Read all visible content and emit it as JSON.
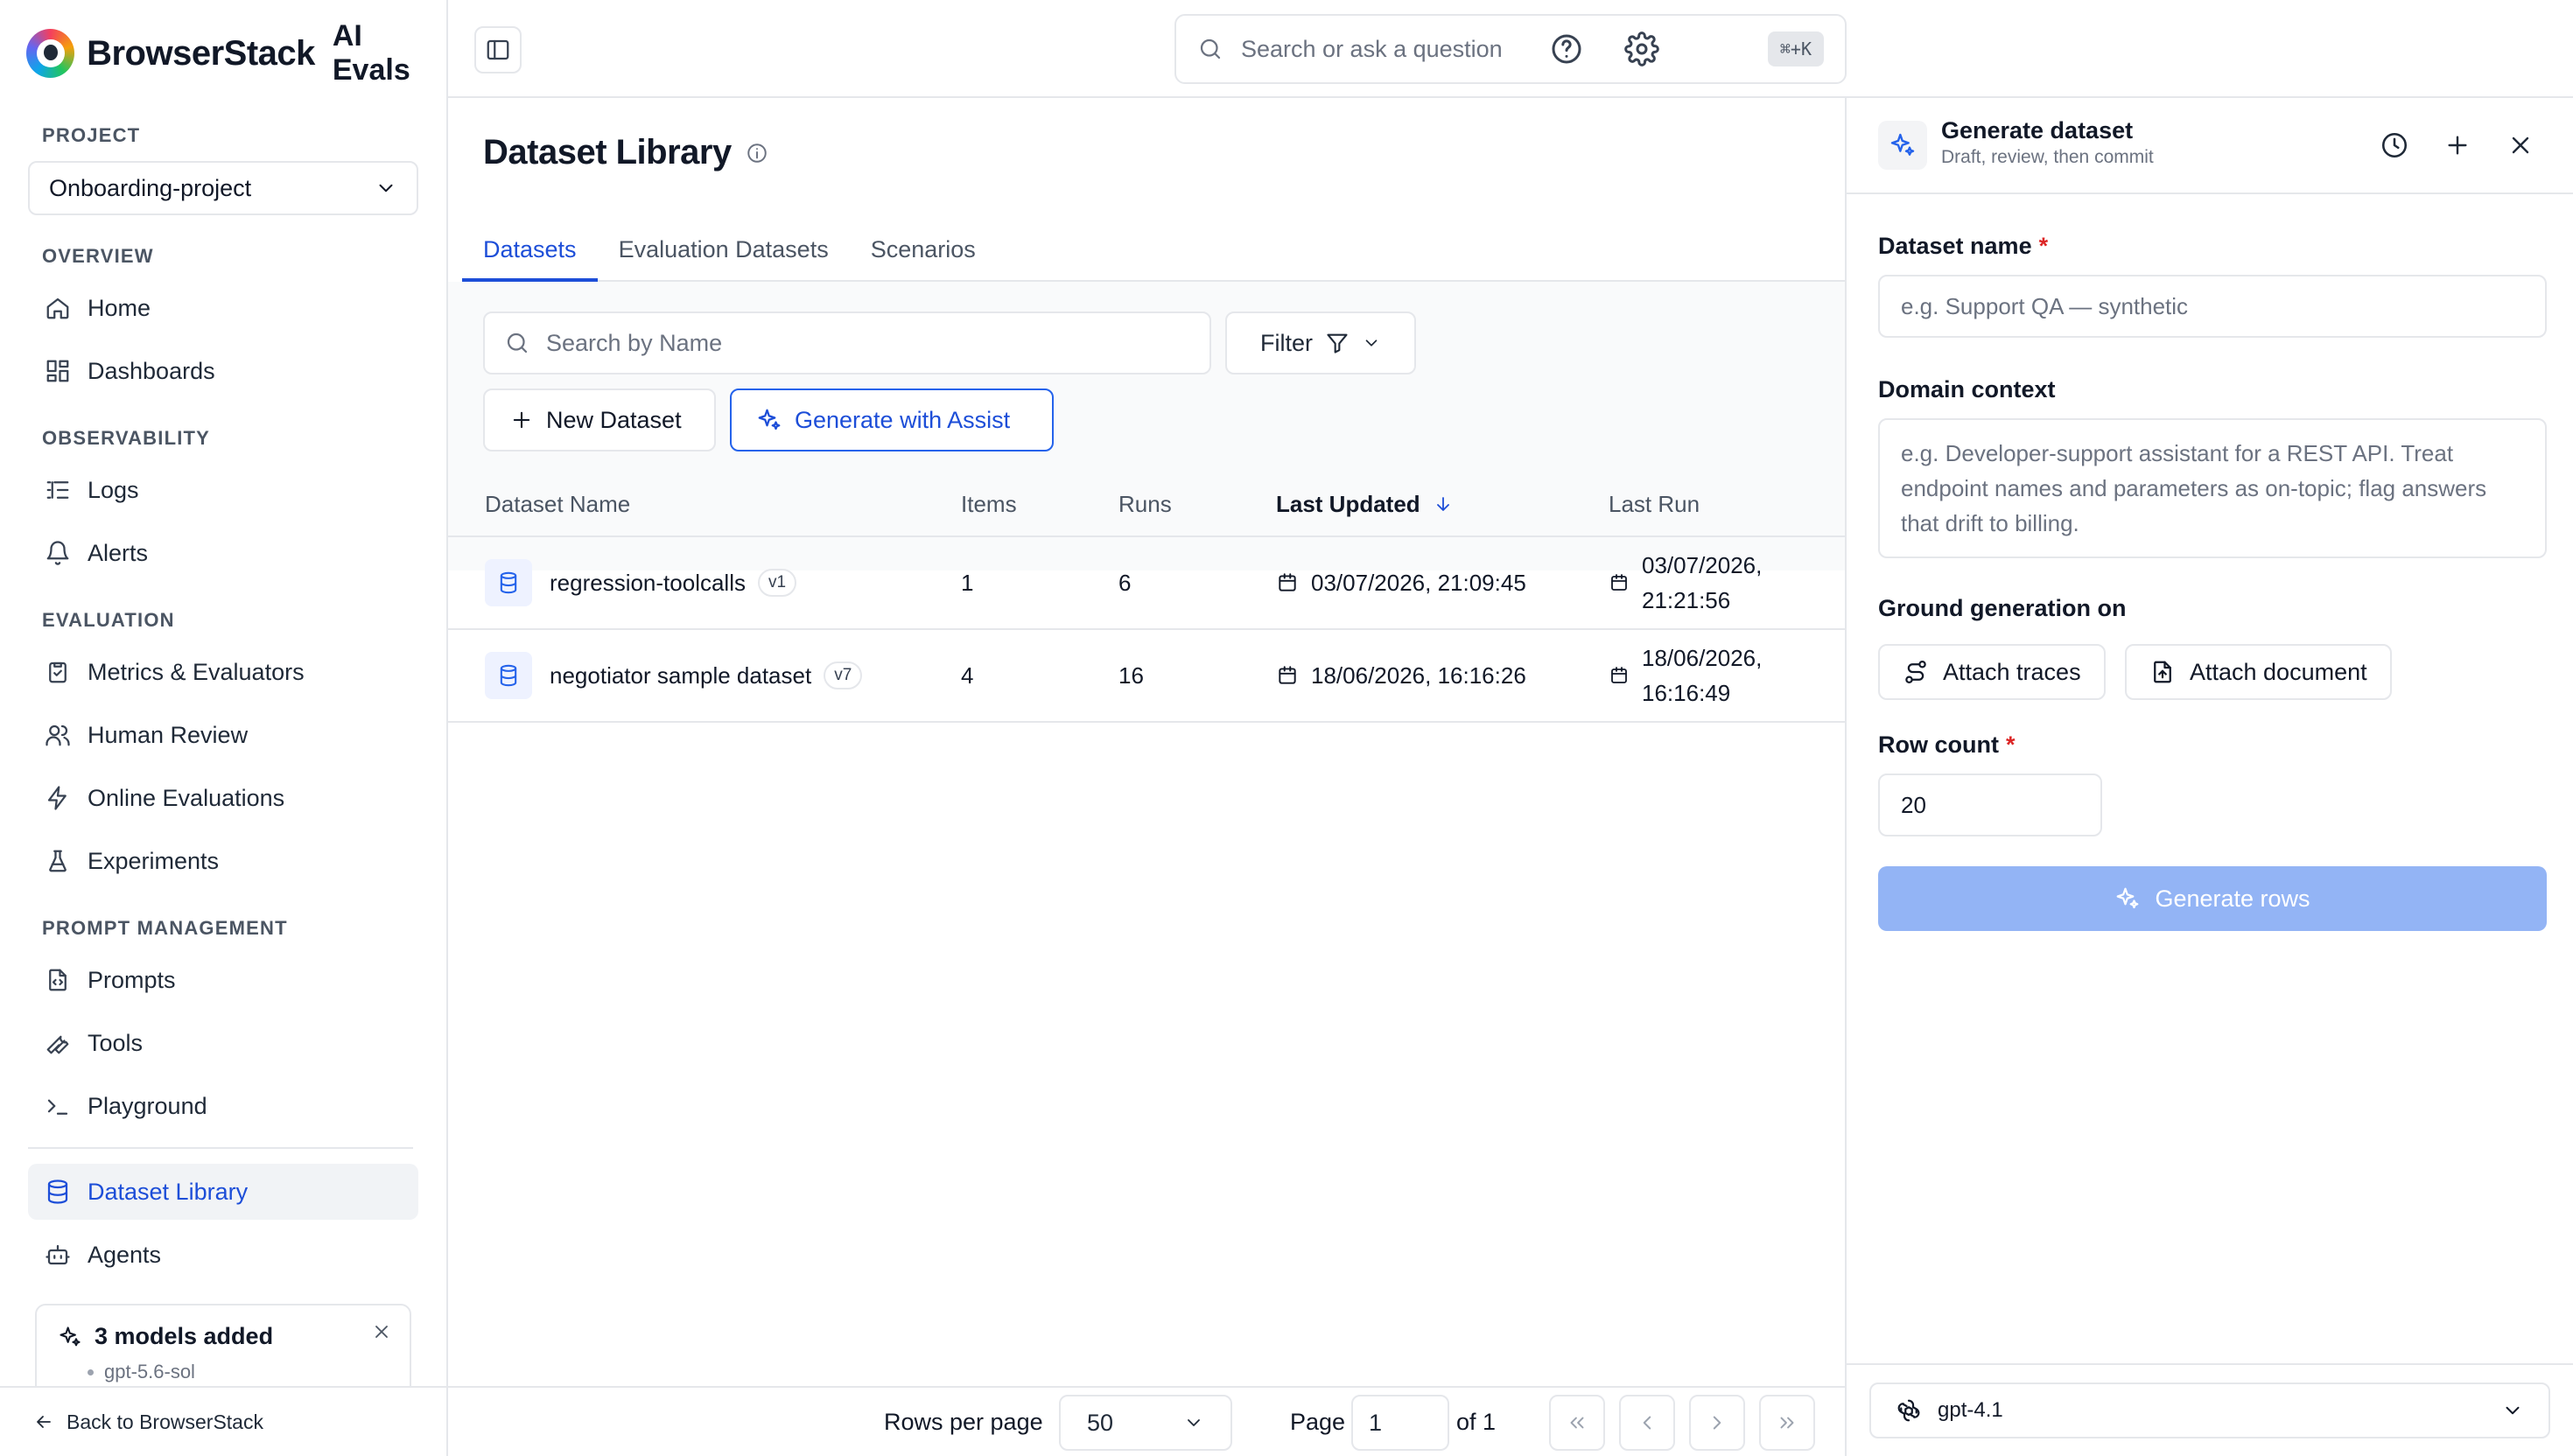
{
  "brand": {
    "name": "BrowserStack",
    "suffix": "AI Evals"
  },
  "sidebar": {
    "project_label": "PROJECT",
    "project_value": "Onboarding-project",
    "sections": {
      "overview": "OVERVIEW",
      "observability": "OBSERVABILITY",
      "evaluation": "EVALUATION",
      "prompt_management": "PROMPT MANAGEMENT"
    },
    "items": {
      "home": "Home",
      "dashboards": "Dashboards",
      "logs": "Logs",
      "alerts": "Alerts",
      "metrics": "Metrics & Evaluators",
      "human_review": "Human Review",
      "online_evaluations": "Online Evaluations",
      "experiments": "Experiments",
      "prompts": "Prompts",
      "tools": "Tools",
      "playground": "Playground",
      "dataset_library": "Dataset Library",
      "agents": "Agents"
    },
    "active_item": "Dataset Library",
    "notice": {
      "title": "3 models added",
      "first_model": "gpt-5.6-sol"
    },
    "back_link": "Back to BrowserStack"
  },
  "topbar": {
    "search_placeholder": "Search or ask a question",
    "shortcut": "⌘+K"
  },
  "main": {
    "title": "Dataset Library",
    "tabs": [
      "Datasets",
      "Evaluation Datasets",
      "Scenarios"
    ],
    "active_tab": "Datasets",
    "search_placeholder": "Search by Name",
    "filter_label": "Filter",
    "new_dataset_label": "New Dataset",
    "assist_label": "Generate with Assist",
    "columns": {
      "name": "Dataset Name",
      "items": "Items",
      "runs": "Runs",
      "last_updated": "Last Updated",
      "last_run": "Last Run"
    },
    "rows": [
      {
        "name": "regression-toolcalls",
        "version": "v1",
        "items": "1",
        "runs": "6",
        "last_updated": "03/07/2026, 21:09:45",
        "last_run_date": "03/07/2026,",
        "last_run_time": "21:21:56"
      },
      {
        "name": "negotiator sample dataset",
        "version": "v7",
        "items": "4",
        "runs": "16",
        "last_updated": "18/06/2026, 16:16:26",
        "last_run_date": "18/06/2026,",
        "last_run_time": "16:16:49"
      }
    ],
    "pager": {
      "rows_per_page_label": "Rows per page",
      "rows_per_page": "50",
      "page_label": "Page",
      "page": "1",
      "of_label": "of 1"
    }
  },
  "panel": {
    "title": "Generate dataset",
    "subtitle": "Draft, review, then commit",
    "dataset_name_label": "Dataset name",
    "dataset_name_placeholder": "e.g. Support QA — synthetic",
    "domain_label": "Domain context",
    "domain_placeholder": "e.g. Developer-support assistant for a REST API. Treat endpoint names and parameters as on-topic; flag answers that drift to billing.",
    "ground_label": "Ground generation on",
    "attach_traces": "Attach traces",
    "attach_document": "Attach document",
    "row_count_label": "Row count",
    "row_count_value": "20",
    "generate_label": "Generate rows",
    "model": "gpt-4.1"
  },
  "colors": {
    "accent": "#1d4ed8",
    "generate_disabled": "#93b4f5",
    "required": "#dc2626"
  }
}
